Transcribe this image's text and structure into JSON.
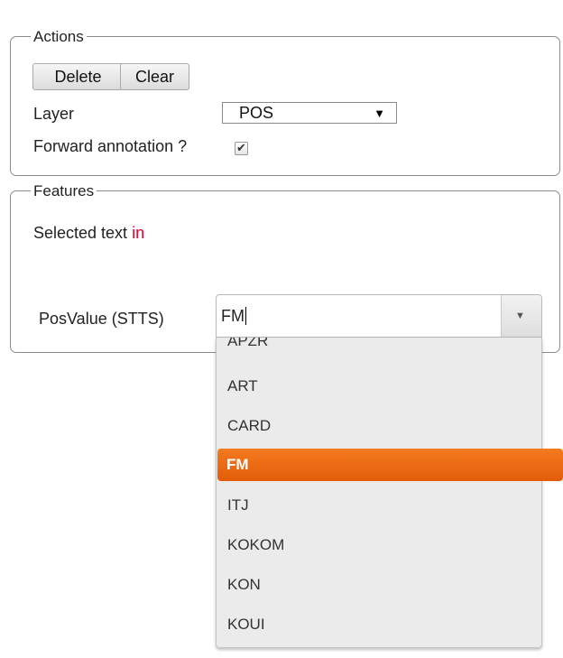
{
  "actions": {
    "legend": "Actions",
    "delete_label": "Delete",
    "clear_label": "Clear",
    "layer_label": "Layer",
    "layer_value": "POS",
    "forward_label": "Forward annotation ?",
    "forward_checked": true
  },
  "features": {
    "legend": "Features",
    "selected_text_label": "Selected text",
    "selected_text_value": "in",
    "posvalue_label": "PosValue (STTS)",
    "posvalue_input": "FM",
    "options": [
      "APZR",
      "ART",
      "CARD",
      "FM",
      "ITJ",
      "KOKOM",
      "KON",
      "KOUI"
    ],
    "selected_option": "FM"
  },
  "colors": {
    "highlight": "#ee6a12",
    "selected_text_value": "#e8002d"
  }
}
